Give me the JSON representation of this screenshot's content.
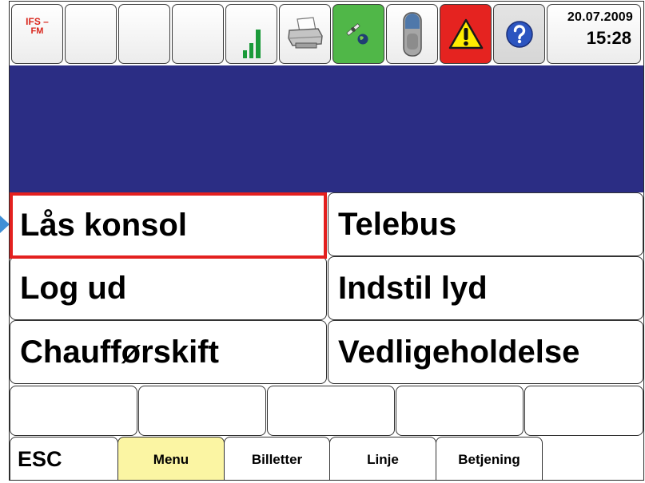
{
  "status_bar": {
    "logo": {
      "line1": "IFS –",
      "line2": "FM"
    },
    "icons": [
      "signal-icon",
      "printer-icon",
      "gps-icon",
      "device-icon",
      "warning-icon",
      "help-icon"
    ],
    "date": "20.07.2009",
    "time": "15:28"
  },
  "menu": {
    "selected_index": 0,
    "items": [
      {
        "label": "Lås konsol"
      },
      {
        "label": "Telebus"
      },
      {
        "label": "Log ud"
      },
      {
        "label": "Indstil lyd"
      },
      {
        "label": "Chaufførskift"
      },
      {
        "label": "Vedligeholdelse"
      }
    ]
  },
  "tabs": {
    "active_index": 1,
    "items": [
      {
        "label": "ESC"
      },
      {
        "label": "Menu"
      },
      {
        "label": "Billetter"
      },
      {
        "label": "Linje"
      },
      {
        "label": "Betjening"
      }
    ]
  },
  "colors": {
    "message_area": "#2b2d84",
    "selection_border": "#e3201f",
    "active_tab": "#fbf5a3",
    "gps_button": "#50b748",
    "warning_button": "#e52320",
    "help_button": "#d6d6d6",
    "pointer": "#3f8fd6"
  }
}
